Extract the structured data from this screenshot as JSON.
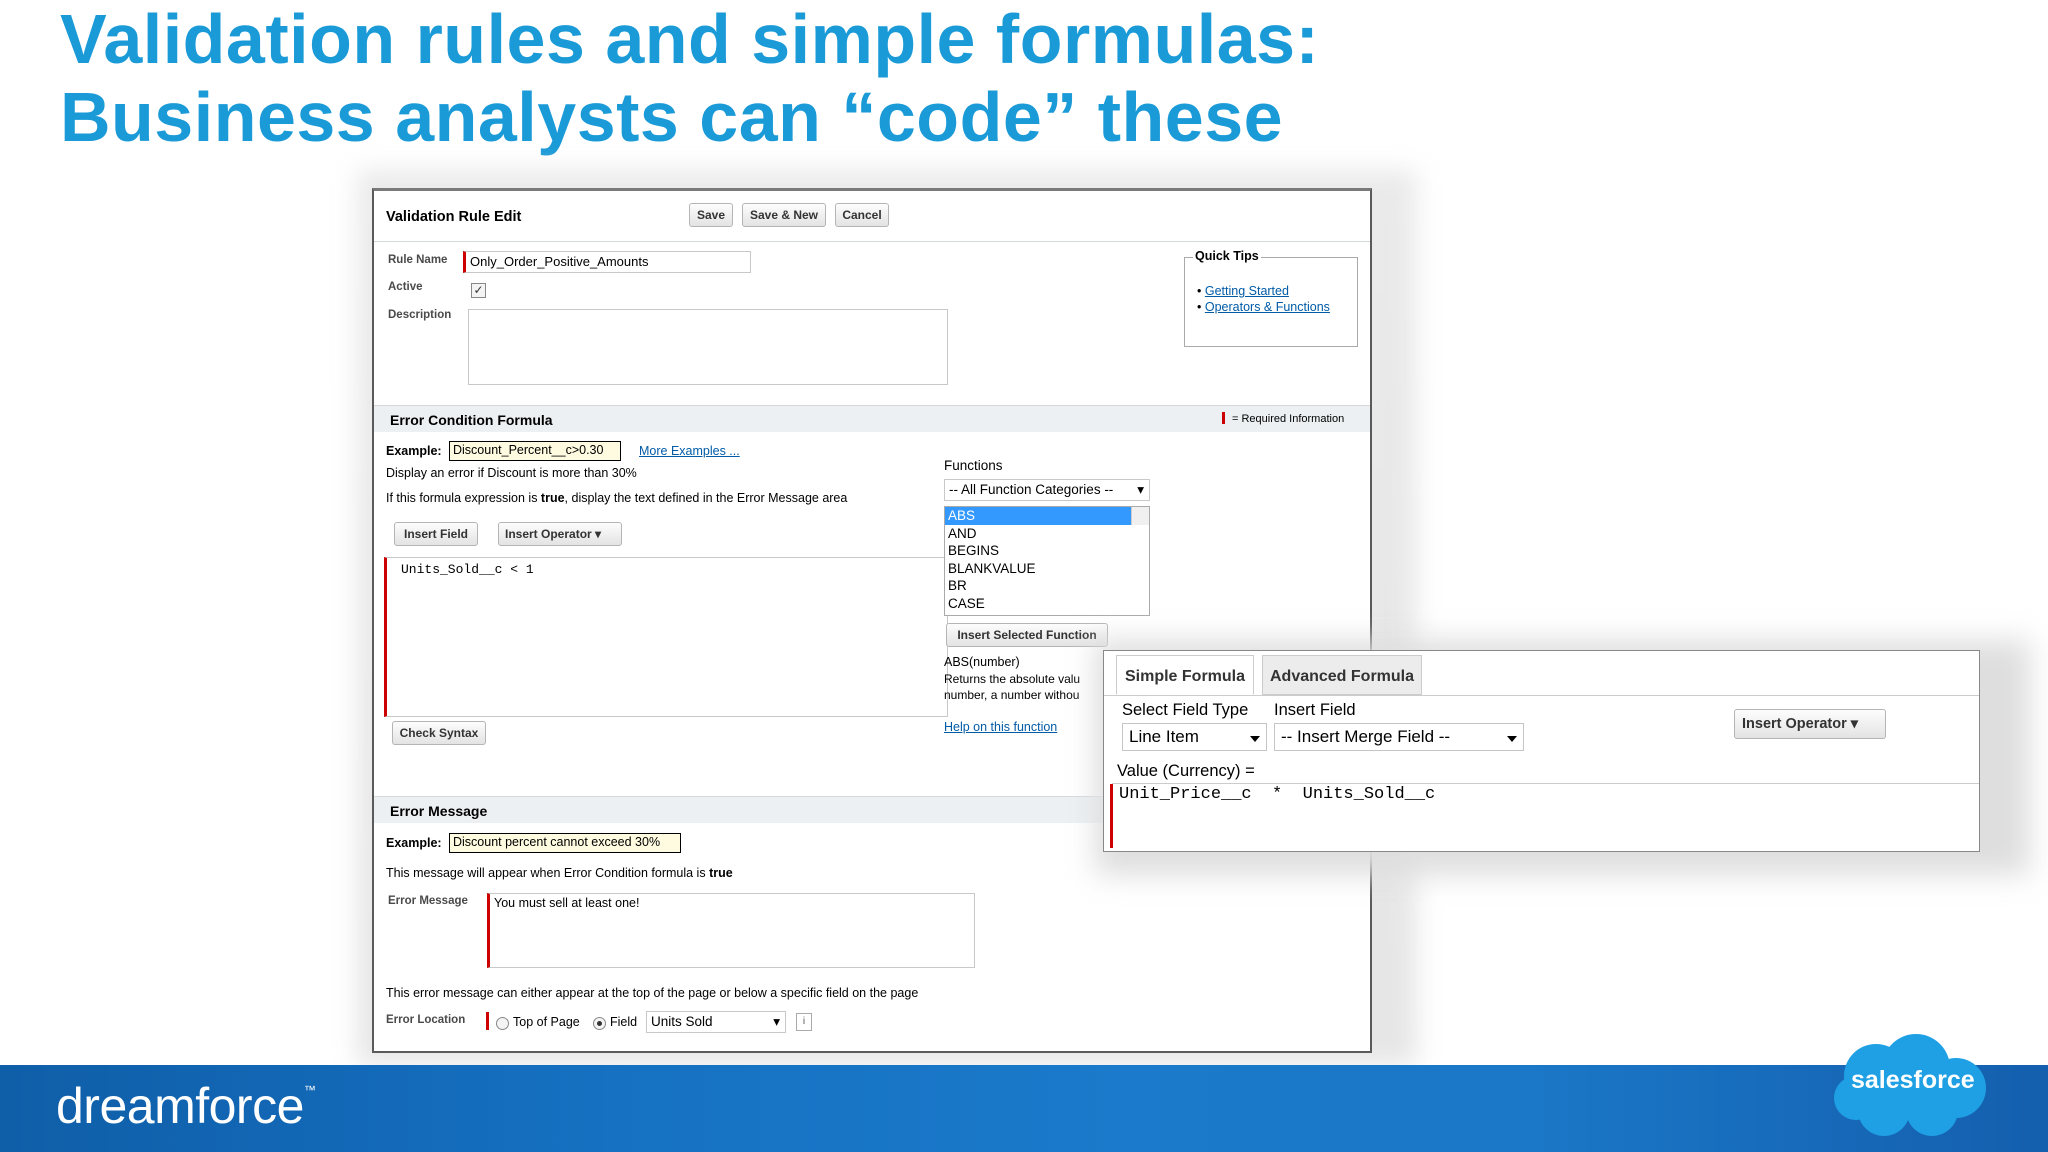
{
  "slide": {
    "title_line1": "Validation rules and simple formulas:",
    "title_line2": "Business analysts can “code” these"
  },
  "editor": {
    "title": "Validation Rule Edit",
    "buttons": {
      "save": "Save",
      "save_new": "Save & New",
      "cancel": "Cancel"
    },
    "rule_name_label": "Rule Name",
    "rule_name_value": "Only_Order_Positive_Amounts",
    "active_label": "Active",
    "active_checked": true,
    "description_label": "Description",
    "description_value": "",
    "quick_tips": {
      "title": "Quick Tips",
      "links": [
        "Getting Started",
        "Operators & Functions"
      ]
    },
    "error_condition": {
      "section_title": "Error Condition Formula",
      "required_legend": "= Required Information",
      "example_label": "Example:",
      "example_value": "Discount_Percent__c>0.30",
      "more_examples": "More Examples ...",
      "line1": "Display an error if Discount is more than 30%",
      "line2_pre": "If this formula expression is ",
      "line2_bold": "true",
      "line2_post": ", display the text defined in the Error Message area",
      "insert_field": "Insert Field",
      "insert_operator": "Insert Operator",
      "formula": "Units_Sold__c < 1",
      "check_syntax": "Check Syntax",
      "functions_label": "Functions",
      "function_category": "-- All Function Categories --",
      "functions": [
        "ABS",
        "AND",
        "BEGINS",
        "BLANKVALUE",
        "BR",
        "CASE"
      ],
      "selected_function": "ABS",
      "insert_selected_function": "Insert Selected Function",
      "fn_signature": "ABS(number)",
      "fn_desc1": "Returns the absolute valu",
      "fn_desc2": "number, a number withou",
      "fn_help": "Help on this function"
    },
    "error_message": {
      "section_title": "Error Message",
      "example_label": "Example:",
      "example_value": "Discount percent cannot exceed 30%",
      "line1_pre": "This message will appear when Error Condition formula is ",
      "line1_bold": "true",
      "message_label": "Error Message",
      "message_value": "You must sell at least one!",
      "location_note": "This error message can either appear at the top of the page or below a specific field on the page",
      "location_label": "Error Location",
      "option_top": "Top of Page",
      "option_field": "Field",
      "selected_option": "Field",
      "field_value": "Units Sold",
      "info_icon": "i"
    }
  },
  "formula_popup": {
    "tabs": [
      "Simple Formula",
      "Advanced Formula"
    ],
    "active_tab": "Simple Formula",
    "field_type_label": "Select Field Type",
    "field_type_value": "Line Item",
    "insert_field_label": "Insert Field",
    "insert_field_value": "-- Insert Merge Field --",
    "insert_operator": "Insert Operator",
    "value_label": "Value (Currency) =",
    "formula": "Unit_Price__c  *  Units_Sold__c"
  },
  "footer": {
    "brand_left": "dreamforce",
    "brand_right": "salesforce"
  },
  "colors": {
    "title_blue": "#1a9ad7",
    "footer_blue": "#1671c2",
    "cloud_blue": "#1fa0e4",
    "required_red": "#cc0000"
  }
}
